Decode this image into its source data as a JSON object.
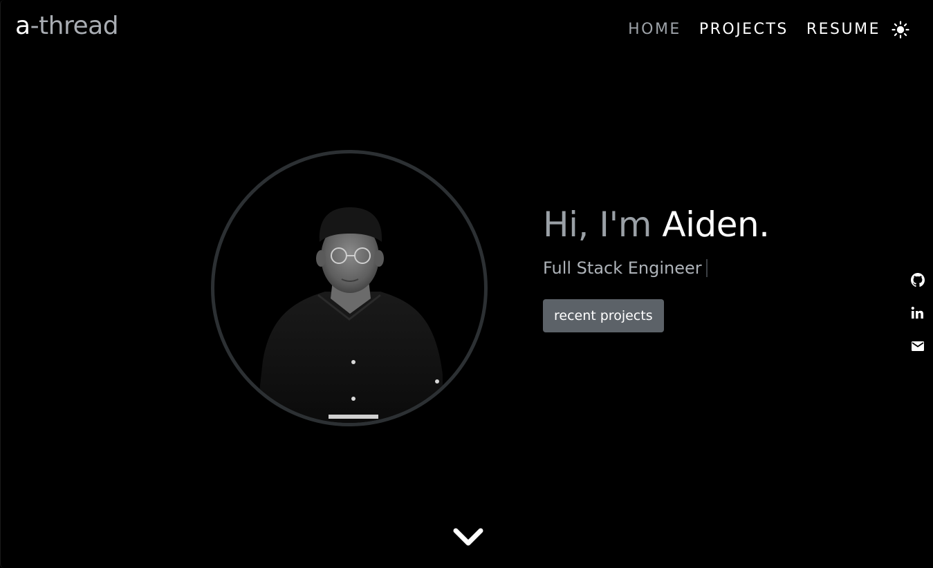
{
  "brand": {
    "prefix": "a",
    "suffix": "-thread"
  },
  "nav": {
    "items": [
      {
        "label": "HOME"
      },
      {
        "label": "PROJECTS"
      },
      {
        "label": "RESUME"
      }
    ],
    "theme_toggle_icon": "sun-icon"
  },
  "hero": {
    "greeting": "Hi, I'm ",
    "name": "Aiden.",
    "role": "Full Stack Engineer",
    "cta_label": "recent projects",
    "avatar_icon": "profile-photo"
  },
  "social": {
    "icons": [
      "github-icon",
      "linkedin-icon",
      "email-icon"
    ]
  },
  "scroll": {
    "icon": "chevron-down-icon"
  },
  "colors": {
    "background": "#000000",
    "text_primary": "#ffffff",
    "text_muted": "#9aa0a6",
    "button_bg": "#5c6268",
    "ring": "#2c3033"
  }
}
